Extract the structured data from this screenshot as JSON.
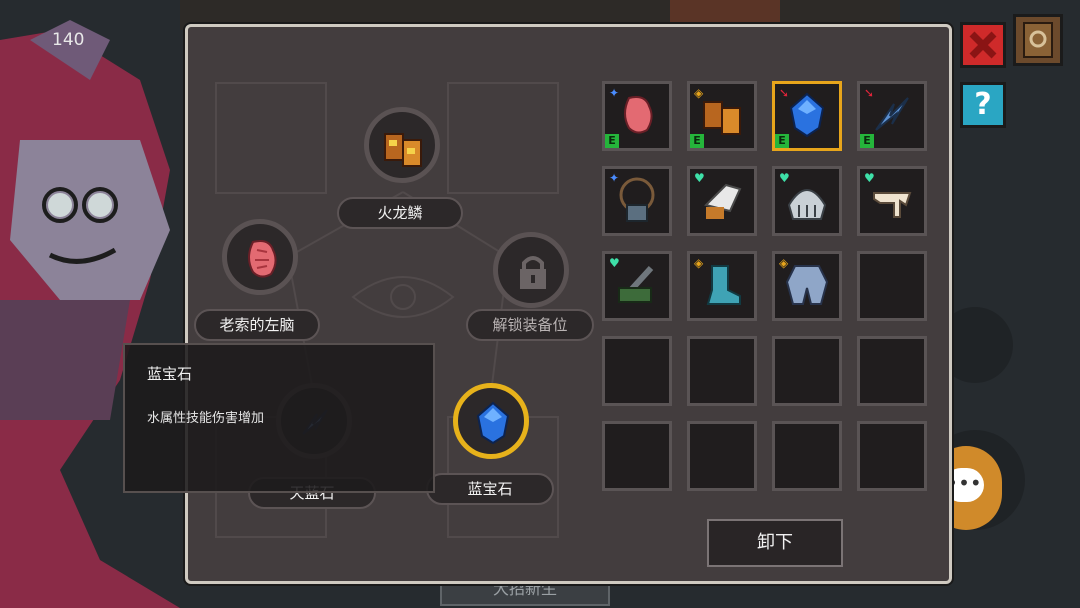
{
  "hud": {
    "count": "140"
  },
  "buttons": {
    "help": "?",
    "bottom": "大招新生"
  },
  "equip_slots": [
    {
      "label": "火龙鳞",
      "icon": "fire-dragon-scale-icon"
    },
    {
      "label": "老索的左脑",
      "icon": "left-brain-icon"
    },
    {
      "label": "解锁装备位",
      "icon": "lock-icon"
    },
    {
      "label": "天蓝石",
      "icon": "sky-stone-icon"
    },
    {
      "label": "蓝宝石",
      "icon": "sapphire-icon"
    }
  ],
  "inventory": {
    "rows": [
      [
        {
          "icon": "left-brain-icon",
          "badge": "E"
        },
        {
          "icon": "fire-dragon-scale-icon",
          "badge": "E"
        },
        {
          "icon": "sapphire-icon",
          "badge": "E"
        },
        {
          "icon": "sky-stone-icon",
          "badge": "E"
        }
      ],
      [
        {
          "icon": "amulet-icon",
          "badge": ""
        },
        {
          "icon": "wing-boot-icon",
          "badge": ""
        },
        {
          "icon": "helmet-icon",
          "badge": ""
        },
        {
          "icon": "bone-icon",
          "badge": ""
        }
      ],
      [
        {
          "icon": "cannon-icon",
          "badge": ""
        },
        {
          "icon": "boot-icon",
          "badge": ""
        },
        {
          "icon": "armor-icon",
          "badge": ""
        },
        {
          "icon": "",
          "badge": ""
        }
      ]
    ]
  },
  "unequip_label": "卸下",
  "tooltip": {
    "title": "蓝宝石",
    "description": "水属性技能伤害增加"
  },
  "colors": {
    "accent": "#e7a51b",
    "badge_green": "#25b53b",
    "panel": "#433d3e"
  }
}
